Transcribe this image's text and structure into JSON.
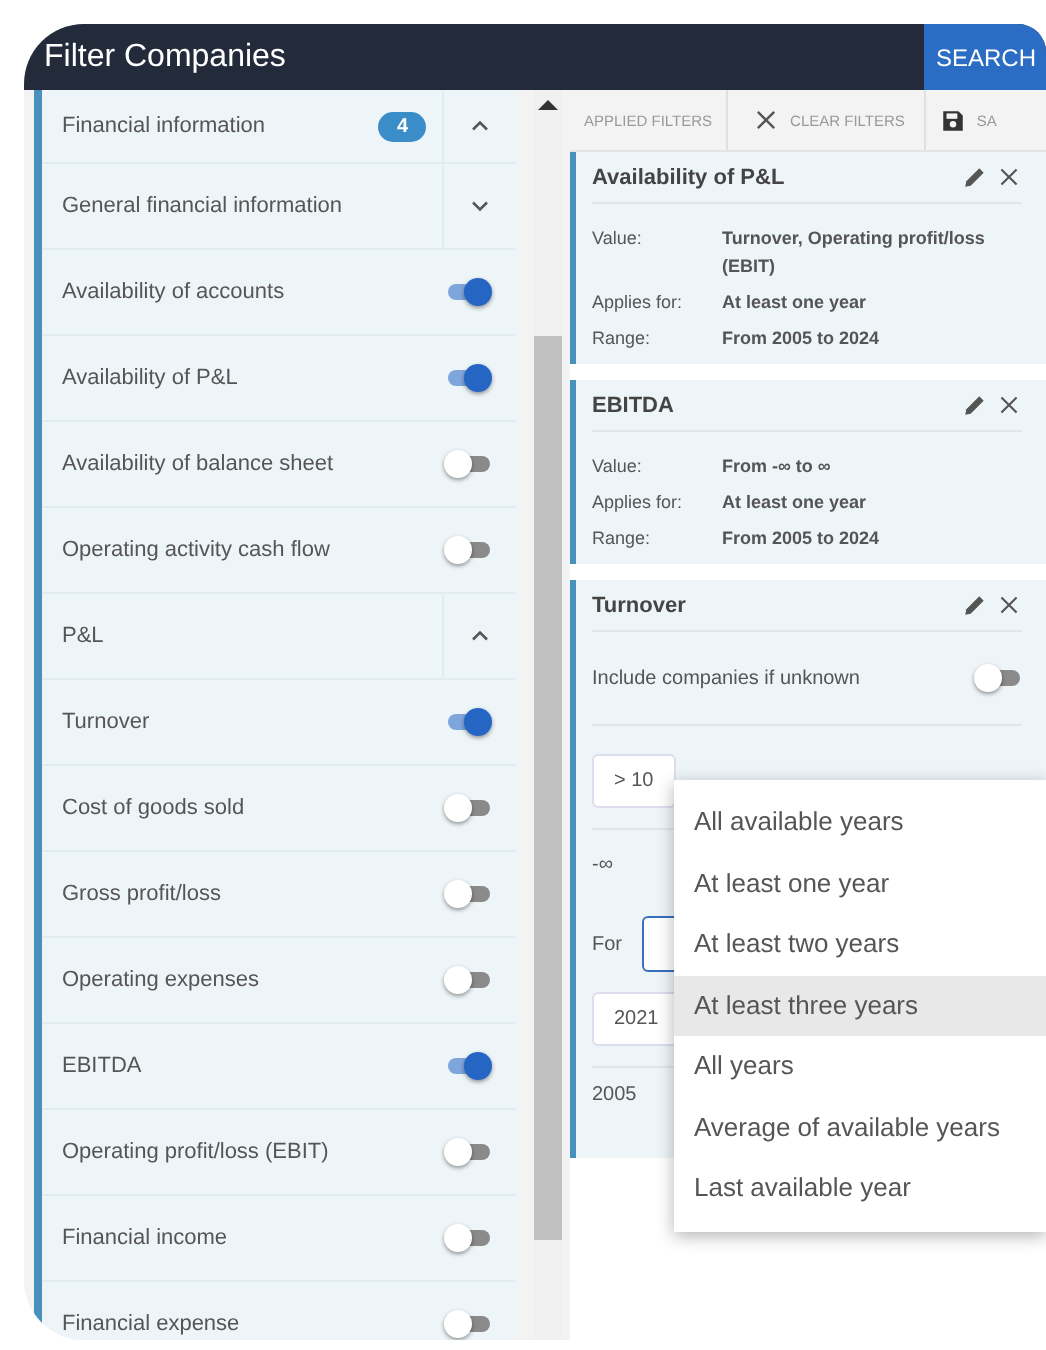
{
  "header": {
    "title": "Filter Companies",
    "search_button": "SEARCH"
  },
  "sidebar": {
    "items": [
      {
        "kind": "group",
        "label": "Financial information",
        "badge": "4",
        "expanded": true,
        "children": [
          {
            "kind": "group",
            "label": "General financial information",
            "expanded": false
          },
          {
            "kind": "toggle",
            "label": "Availability of accounts",
            "on": true
          },
          {
            "kind": "toggle",
            "label": "Availability of P&L",
            "on": true
          },
          {
            "kind": "toggle",
            "label": "Availability of balance sheet",
            "on": false
          },
          {
            "kind": "toggle",
            "label": "Operating activity cash flow",
            "on": false
          },
          {
            "kind": "group",
            "label": "P&L",
            "expanded": true,
            "children": [
              {
                "kind": "toggle",
                "label": "Turnover",
                "on": true
              },
              {
                "kind": "toggle",
                "label": "Cost of goods sold",
                "on": false
              },
              {
                "kind": "toggle",
                "label": "Gross profit/loss",
                "on": false
              },
              {
                "kind": "toggle",
                "label": "Operating expenses",
                "on": false
              },
              {
                "kind": "toggle",
                "label": "EBITDA",
                "on": true
              },
              {
                "kind": "toggle",
                "label": "Operating profit/loss (EBIT)",
                "on": false
              },
              {
                "kind": "toggle",
                "label": "Financial income",
                "on": false
              },
              {
                "kind": "toggle",
                "label": "Financial expense",
                "on": false
              }
            ]
          }
        ]
      }
    ]
  },
  "toolbar": [
    {
      "kind": "tab",
      "label": "APPLIED FILTERS"
    },
    {
      "kind": "clear",
      "label": "CLEAR FILTERS"
    },
    {
      "kind": "save",
      "label": "SA"
    }
  ],
  "filters": [
    {
      "kind": "summary",
      "title": "Availability of P&L",
      "rows": [
        {
          "label": "Value:",
          "value": "Turnover, Operating profit/loss (EBIT)"
        },
        {
          "label": "Applies for:",
          "value": "At least one year"
        },
        {
          "label": "Range:",
          "value": "From 2005 to 2024"
        }
      ]
    },
    {
      "kind": "summary",
      "title": "EBITDA",
      "rows": [
        {
          "label": "Value:",
          "value": "From -∞ to ∞"
        },
        {
          "label": "Applies for:",
          "value": "At least one year"
        },
        {
          "label": "Range:",
          "value": "From 2005 to 2024"
        }
      ]
    },
    {
      "kind": "editor",
      "title": "Turnover",
      "include_unknown": {
        "label": "Include companies if unknown",
        "on": false
      },
      "value_field": "> 10",
      "range_min": "-∞",
      "for_label": "For",
      "year_field": "2021",
      "year_min": "2005"
    }
  ],
  "dropdown": {
    "options": [
      {
        "label": "All available years",
        "selected": false
      },
      {
        "label": "At least one year",
        "selected": false
      },
      {
        "label": "At least two years",
        "selected": false
      },
      {
        "label": "At least three years",
        "selected": true
      },
      {
        "label": "All years",
        "selected": false
      },
      {
        "label": "Average of available years",
        "selected": false
      },
      {
        "label": "Last available year",
        "selected": false
      }
    ]
  }
}
